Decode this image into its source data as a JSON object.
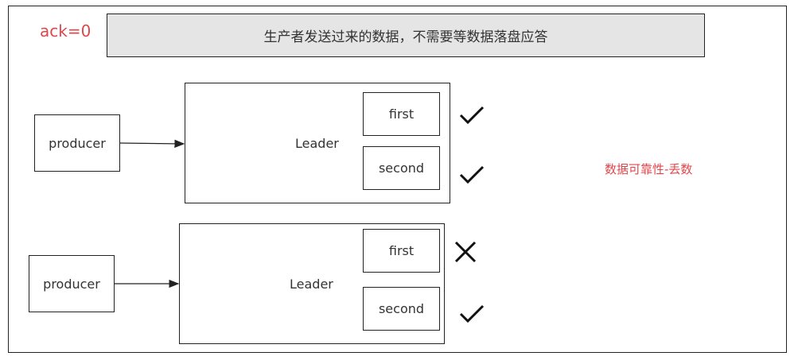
{
  "ack_label": "ack=0",
  "banner_text": "生产者发送过来的数据，不需要等数据落盘应答",
  "note_text": "数据可靠性-丢数",
  "scenarios": [
    {
      "producer": "producer",
      "leader": "Leader",
      "messages": [
        {
          "label": "first",
          "status": "check"
        },
        {
          "label": "second",
          "status": "check"
        }
      ]
    },
    {
      "producer": "producer",
      "leader": "Leader",
      "messages": [
        {
          "label": "first",
          "status": "cross"
        },
        {
          "label": "second",
          "status": "check"
        }
      ]
    }
  ],
  "colors": {
    "accent_red": "#e0474c",
    "banner_bg": "#e5e5e5",
    "stroke": "#222222",
    "text": "#333333"
  }
}
